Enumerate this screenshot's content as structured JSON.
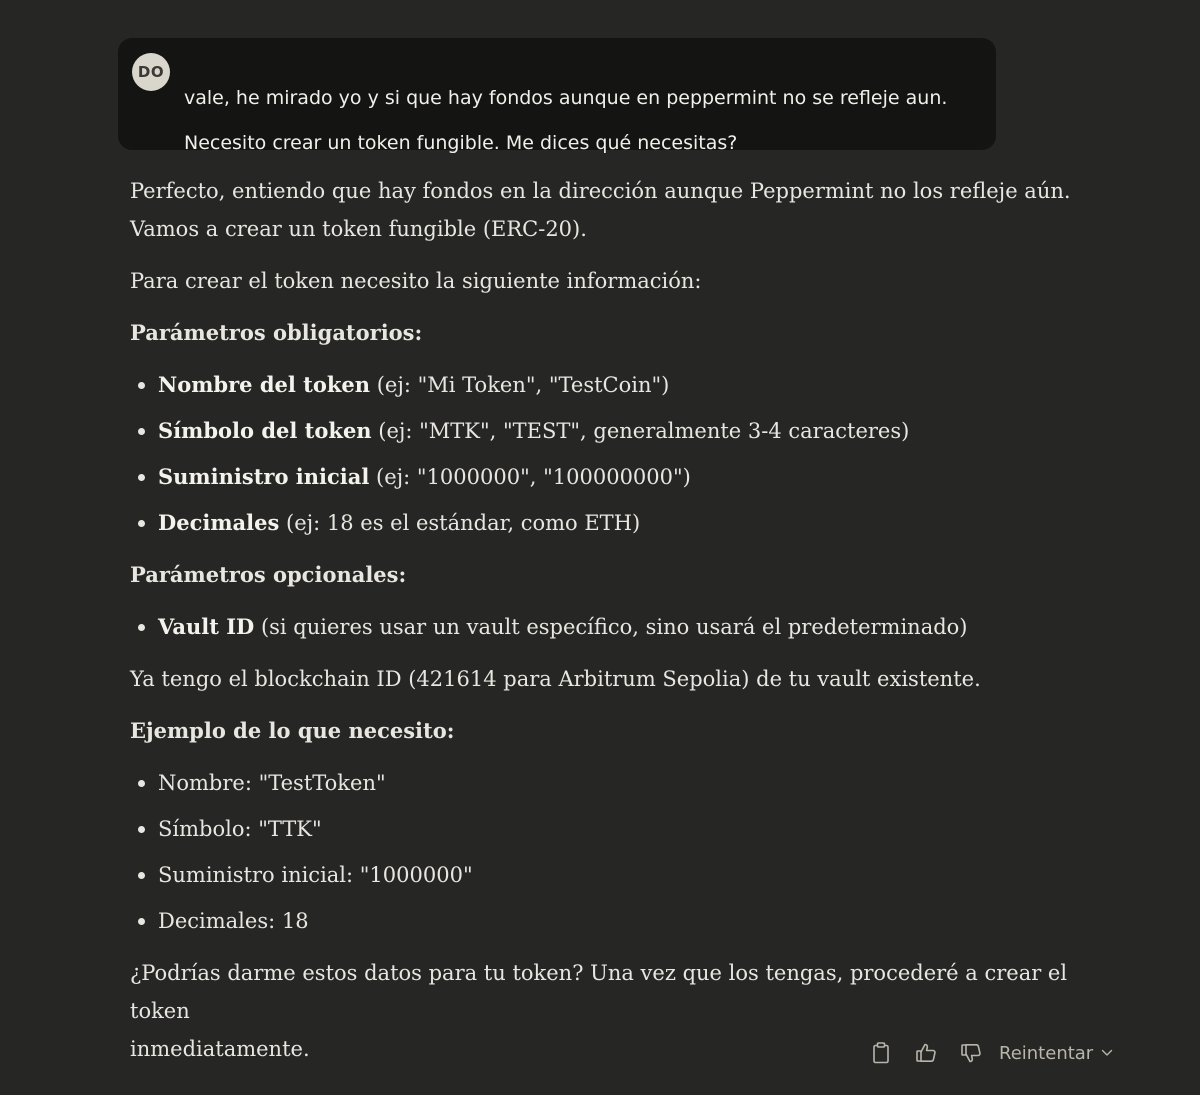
{
  "user_message": {
    "avatar_initials": "DO",
    "line1": "vale, he mirado yo y si que hay fondos aunque en peppermint no se refleje aun.",
    "line2": "Necesito crear un token fungible. Me dices qué necesitas?"
  },
  "assistant": {
    "intro_line1": "Perfecto, entiendo que hay fondos en la dirección aunque Peppermint no los refleje aún.",
    "intro_line2": "Vamos a crear un token fungible (ERC-20).",
    "need_info": "Para crear el token necesito la siguiente información:",
    "required_heading": "Parámetros obligatorios:",
    "required_items": [
      {
        "label": "Nombre del token",
        "detail": " (ej: \"Mi Token\", \"TestCoin\")"
      },
      {
        "label": "Símbolo del token",
        "detail": " (ej: \"MTK\", \"TEST\", generalmente 3-4 caracteres)"
      },
      {
        "label": "Suministro inicial",
        "detail": " (ej: \"1000000\", \"100000000\")"
      },
      {
        "label": "Decimales",
        "detail": " (ej: 18 es el estándar, como ETH)"
      }
    ],
    "optional_heading": "Parámetros opcionales:",
    "optional_items": [
      {
        "label": "Vault ID",
        "detail": " (si quieres usar un vault específico, sino usará el predeterminado)"
      }
    ],
    "blockchain_note": "Ya tengo el blockchain ID (421614 para Arbitrum Sepolia) de tu vault existente.",
    "example_heading": "Ejemplo de lo que necesito:",
    "example_items": [
      "Nombre: \"TestToken\"",
      "Símbolo: \"TTK\"",
      "Suministro inicial: \"1000000\"",
      "Decimales: 18"
    ],
    "closing_line1": "¿Podrías darme estos datos para tu token? Una vez que los tengas, procederé a crear el token",
    "closing_line2": "inmediatamente."
  },
  "actions": {
    "retry_label": "Reintentar",
    "icons": [
      "copy-icon",
      "thumbs-up-icon",
      "thumbs-down-icon",
      "chevron-down-icon"
    ]
  }
}
